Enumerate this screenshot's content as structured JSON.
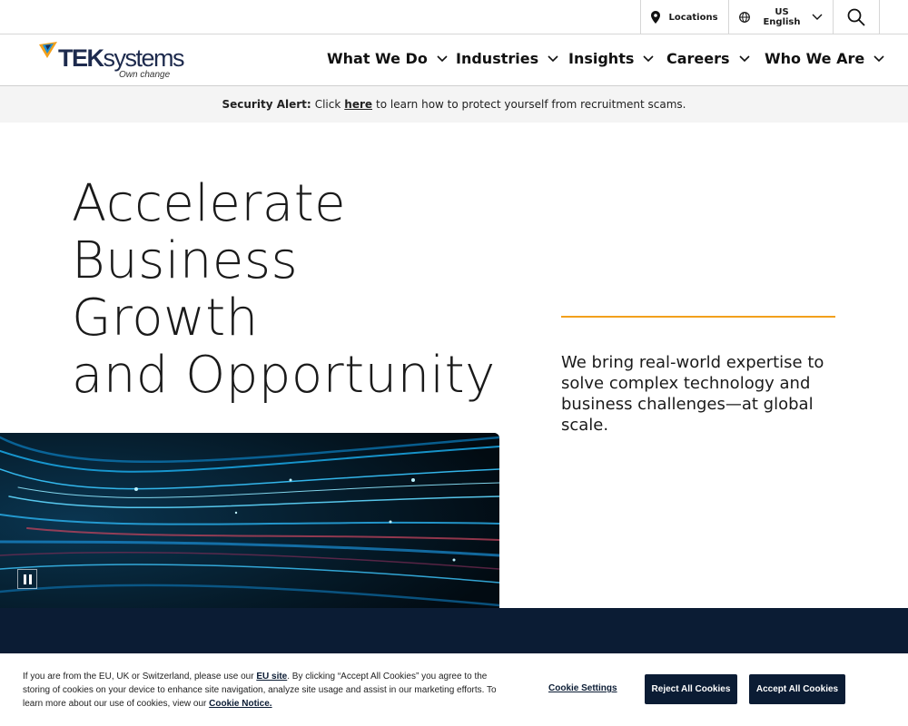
{
  "utility": {
    "locations_label": "Locations",
    "lang_region": "US",
    "lang_language": "English"
  },
  "logo": {
    "brand_bold": "TEK",
    "brand_rest": "systems",
    "tagline": "Own change"
  },
  "nav": {
    "items": [
      {
        "label": "What We Do"
      },
      {
        "label": "Industries"
      },
      {
        "label": "Insights"
      },
      {
        "label": "Careers"
      },
      {
        "label": "Who We Are"
      }
    ]
  },
  "alert": {
    "prefix": "Security Alert:",
    "lead": "Click",
    "link": "here",
    "rest": "to learn how to protect yourself from recruitment scams."
  },
  "hero": {
    "title_line1": "Accelerate",
    "title_line2": "Business Growth",
    "title_line3": "and Opportunity",
    "description": "We bring real-world expertise to solve complex technology and business challenges—at global scale."
  },
  "cookie": {
    "text_part1": "If you are from the EU, UK or Switzerland, please use our",
    "eu_link": "EU site",
    "text_part2": ". By clicking “Accept All Cookies” you agree to the storing of cookies on your device to enhance site navigation, analyze site usage and assist in our marketing efforts. To learn more about our use of cookies, view our",
    "notice_link": "Cookie Notice.",
    "settings_label": "Cookie Settings",
    "reject_label": "Reject All Cookies",
    "accept_label": "Accept All Cookies"
  },
  "colors": {
    "navy": "#0b1c34",
    "accent_orange": "#f2a01c",
    "alert_bg": "#f4f4f4"
  }
}
